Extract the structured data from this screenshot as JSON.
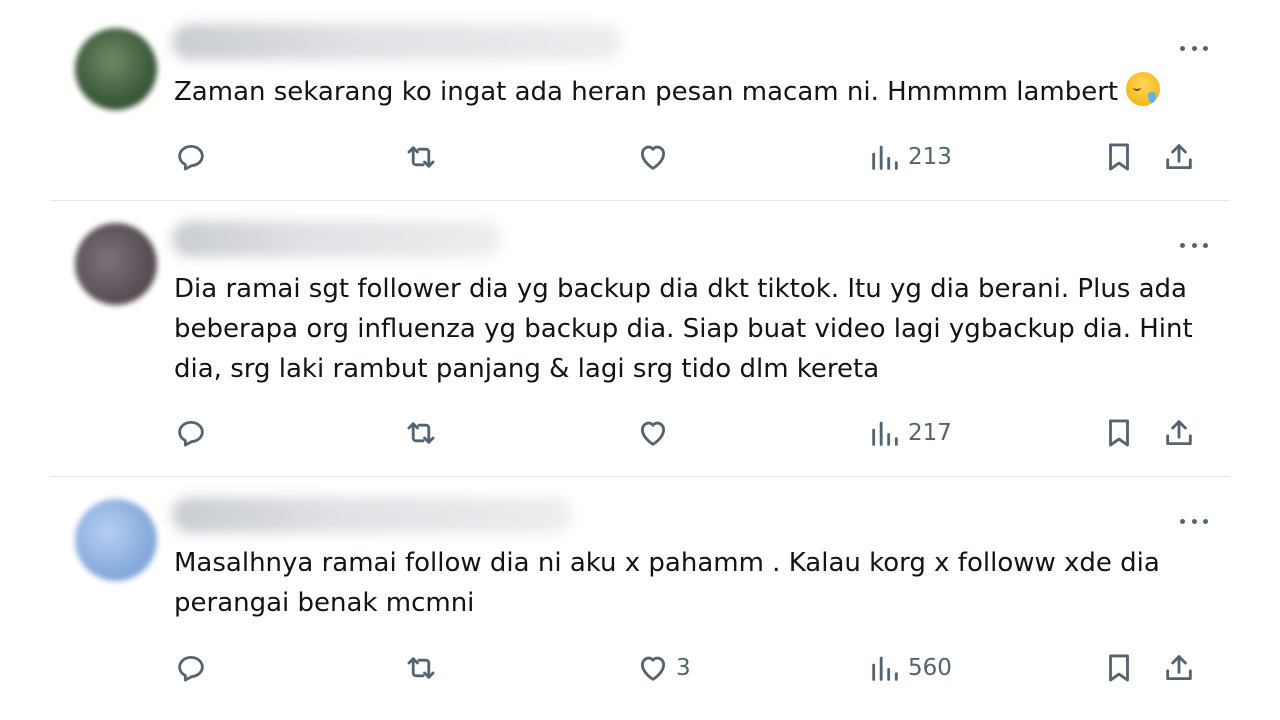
{
  "replies": [
    {
      "text": "Zaman sekarang ko ingat ada heran pesan macam ni. Hmmmm lambert",
      "emoji": "sad-relieved-face-emoji",
      "likes": "",
      "views": "213"
    },
    {
      "text": "Dia ramai sgt follower dia yg backup dia dkt tiktok. Itu yg dia berani. Plus ada beberapa org influenza yg backup dia. Siap buat video lagi ygbackup dia. Hint dia, srg laki rambut panjang & lagi srg tido dlm kereta",
      "likes": "",
      "views": "217"
    },
    {
      "text": "Masalhnya ramai follow dia ni aku x pahamm . Kalau korg x followw xde dia perangai benak mcmni",
      "likes": "3",
      "views": "560"
    }
  ],
  "icons": {
    "reply": "reply-icon",
    "retweet": "retweet-icon",
    "like": "heart-icon",
    "views": "views-icon",
    "bookmark": "bookmark-icon",
    "share": "share-icon",
    "more": "more-icon"
  },
  "colors": {
    "text": "#0f1419",
    "secondary": "#536471",
    "divider": "#e6e9ec"
  }
}
